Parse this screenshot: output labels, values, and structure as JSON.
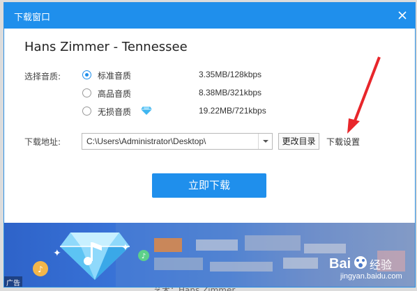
{
  "window": {
    "title": "下载窗口",
    "close_icon": "close-icon"
  },
  "song": {
    "title": "Hans Zimmer - Tennessee"
  },
  "quality": {
    "label": "选择音质:",
    "options": [
      {
        "name": "标准音质",
        "size": "3.35MB/128kbps",
        "selected": true
      },
      {
        "name": "高品音质",
        "size": "8.38MB/321kbps",
        "selected": false
      },
      {
        "name": "无损音质",
        "size": "19.22MB/721kbps",
        "selected": false,
        "badge_icon": "diamond-icon"
      }
    ]
  },
  "download_path": {
    "label": "下载地址:",
    "value": "C:\\Users\\Administrator\\Desktop\\",
    "change_button": "更改目录",
    "settings_link": "下载设置"
  },
  "actions": {
    "download_now": "立即下载"
  },
  "banner": {
    "ad_label": "广告"
  },
  "watermark": {
    "brand": "经验",
    "url": "jingyan.baidu.com"
  },
  "background": {
    "caption": "艺术：Hans Zimmer"
  },
  "colors": {
    "accent": "#1f8fec",
    "annotation_arrow": "#e8262b"
  }
}
